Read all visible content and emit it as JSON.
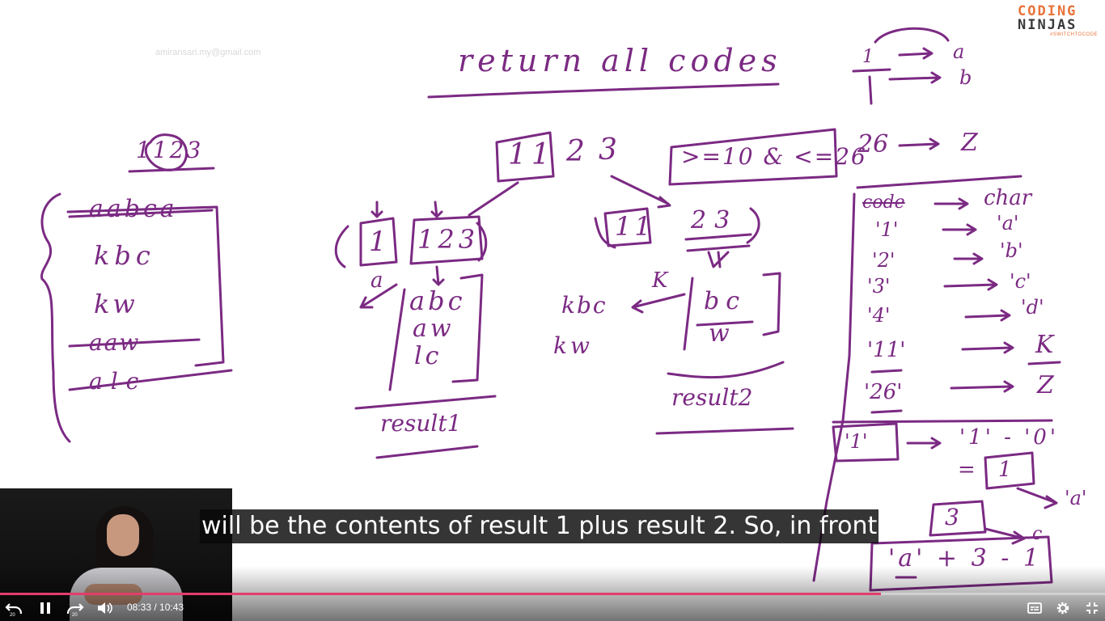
{
  "watermark": "amiransari.my@gmail.com",
  "logo": {
    "line1": "CODING",
    "line2": "NINJAS",
    "tagline": "#SWITCHTOCODE"
  },
  "whiteboard": {
    "title": "return all codes",
    "input_number": "1123",
    "left_list": [
      "aabca",
      "kbc",
      "kw",
      "aaw",
      "alc"
    ],
    "split_left": {
      "first": "1",
      "rest": "123",
      "edge_char": "a",
      "results": [
        "abc",
        "aw",
        "lc"
      ],
      "label": "result1"
    },
    "split_right": {
      "first": "11",
      "rest": "23",
      "edge_char": "K",
      "prefixed": [
        "kbc",
        "kw"
      ],
      "results": [
        "bc",
        "w"
      ],
      "label": "result2"
    },
    "top_number_parts": [
      "11",
      "2",
      "3"
    ],
    "condition": ">=10 & <=26",
    "mapping_top": [
      {
        "from": "1",
        "to": "a"
      },
      {
        "from": "1",
        "to": "b"
      }
    ],
    "mapping_26": {
      "from": "26",
      "to": "Z"
    },
    "table_header": {
      "left": "code",
      "right": "char"
    },
    "table_rows": [
      {
        "code": "'1'",
        "char": "'a'"
      },
      {
        "code": "'2'",
        "char": "'b'"
      },
      {
        "code": "'3'",
        "char": "'c'"
      },
      {
        "code": "'4'",
        "char": "'d'"
      },
      {
        "code": "'11'",
        "char": "K"
      },
      {
        "code": "'26'",
        "char": "Z"
      }
    ],
    "formula_box": "'1'",
    "formula_expr": "'1' - '0'",
    "formula_eq": "= 1",
    "formula_a": "'a'",
    "formula_three": "3",
    "formula_c": "c",
    "formula_final": "'a' + 3 - 1"
  },
  "caption": "will be the contents of result 1 plus result 2. So, in front",
  "player": {
    "current_time": "08:33",
    "duration": "10:43",
    "time_separator": " / ",
    "progress": 0.797,
    "rewind_seconds": "20",
    "forward_seconds": "20",
    "icons": {
      "rewind": "rewind-20-icon",
      "pause": "pause-icon",
      "forward": "forward-20-icon",
      "volume": "volume-icon",
      "captions": "captions-icon",
      "settings": "gear-icon",
      "fullscreen": "exit-fullscreen-icon"
    },
    "accent_color": "#e23d6b"
  }
}
